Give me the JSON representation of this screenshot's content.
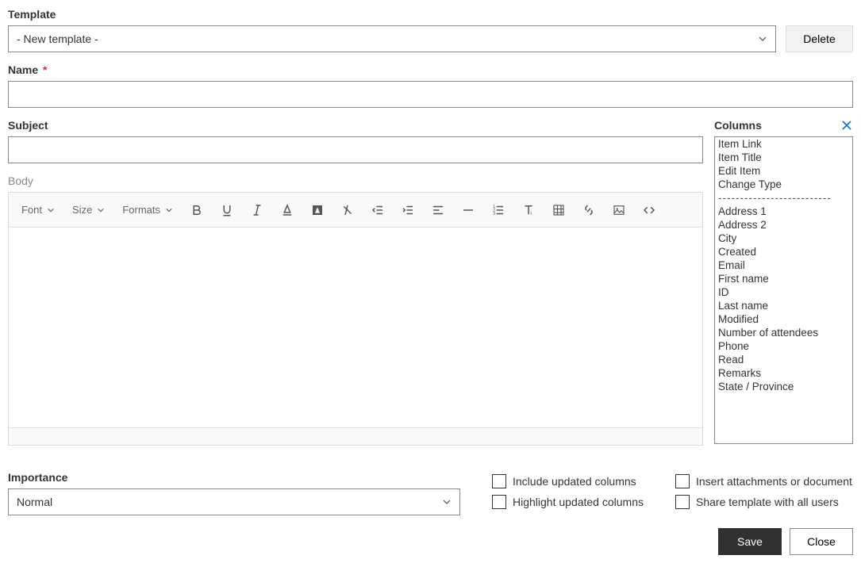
{
  "template": {
    "label": "Template",
    "value": "- New template -",
    "delete_label": "Delete"
  },
  "name": {
    "label": "Name",
    "required": "*",
    "value": ""
  },
  "subject": {
    "label": "Subject",
    "value": ""
  },
  "body": {
    "label": "Body",
    "toolbar": {
      "font_label": "Font",
      "size_label": "Size",
      "formats_label": "Formats"
    }
  },
  "columns": {
    "label": "Columns",
    "items": [
      "Item Link",
      "Item Title",
      "Edit Item",
      "Change Type",
      "---",
      "Address 1",
      "Address 2",
      "City",
      "Created",
      "Email",
      "First name",
      "ID",
      "Last name",
      "Modified",
      "Number of attendees",
      "Phone",
      "Read",
      "Remarks",
      "State / Province"
    ]
  },
  "importance": {
    "label": "Importance",
    "value": "Normal"
  },
  "checkboxes": {
    "include_updated": "Include updated columns",
    "highlight_updated": "Highlight updated columns",
    "insert_attachments": "Insert attachments or document",
    "share_template": "Share template with all users"
  },
  "footer": {
    "save": "Save",
    "close": "Close"
  }
}
